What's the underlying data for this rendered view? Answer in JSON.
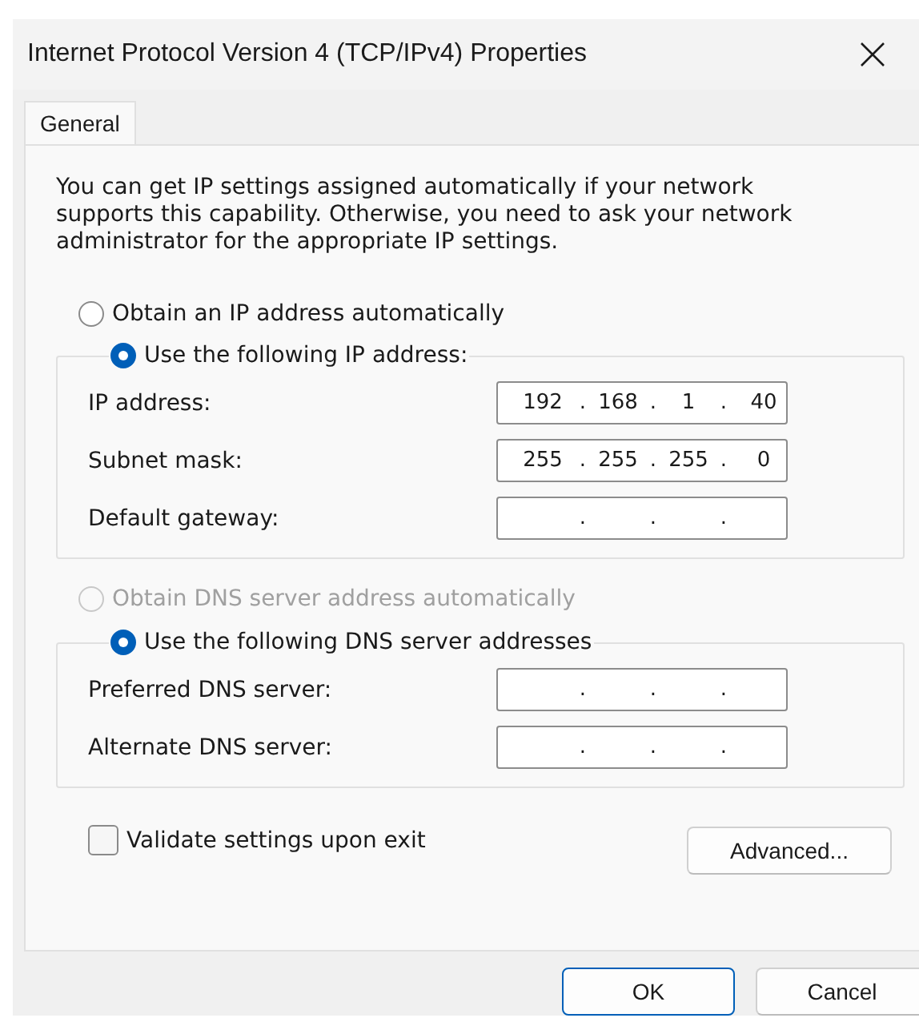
{
  "window": {
    "title": "Internet Protocol Version 4 (TCP/IPv4) Properties"
  },
  "tabs": [
    {
      "label": "General",
      "selected": true
    }
  ],
  "intro": "You can get IP settings assigned automatically if your network supports this capability. Otherwise, you need to ask your network administrator for the appropriate IP settings.",
  "ip_mode": [
    {
      "label": "Obtain an IP address automatically",
      "selected": false,
      "disabled": false
    },
    {
      "label": "Use the following IP address:",
      "selected": true,
      "disabled": false
    }
  ],
  "ip_fields": [
    {
      "label": "IP address:",
      "parts": [
        {
          "kind": "octet",
          "text": "192"
        },
        {
          "kind": "dot",
          "text": "."
        },
        {
          "kind": "octet",
          "text": "168"
        },
        {
          "kind": "dot",
          "text": "."
        },
        {
          "kind": "octet",
          "text": "1"
        },
        {
          "kind": "dot",
          "text": "."
        },
        {
          "kind": "octet",
          "text": "40"
        }
      ]
    },
    {
      "label": "Subnet mask:",
      "parts": [
        {
          "kind": "octet",
          "text": "255"
        },
        {
          "kind": "dot",
          "text": "."
        },
        {
          "kind": "octet",
          "text": "255"
        },
        {
          "kind": "dot",
          "text": "."
        },
        {
          "kind": "octet",
          "text": "255"
        },
        {
          "kind": "dot",
          "text": "."
        },
        {
          "kind": "octet",
          "text": "0"
        }
      ]
    },
    {
      "label": "Default gateway:",
      "parts": [
        {
          "kind": "dot",
          "text": "."
        },
        {
          "kind": "dot",
          "text": "."
        },
        {
          "kind": "dot",
          "text": "."
        }
      ]
    }
  ],
  "dns_mode": [
    {
      "label": "Obtain DNS server address automatically",
      "selected": false,
      "disabled": true
    },
    {
      "label": "Use the following DNS server addresses",
      "selected": true,
      "disabled": false
    }
  ],
  "dns_fields": [
    {
      "label": "Preferred DNS server:",
      "parts": [
        {
          "kind": "dot",
          "text": "."
        },
        {
          "kind": "dot",
          "text": "."
        },
        {
          "kind": "dot",
          "text": "."
        }
      ]
    },
    {
      "label": "Alternate DNS server:",
      "parts": [
        {
          "kind": "dot",
          "text": "."
        },
        {
          "kind": "dot",
          "text": "."
        },
        {
          "kind": "dot",
          "text": "."
        }
      ]
    }
  ],
  "validate": {
    "label": "Validate settings upon exit",
    "checked": false
  },
  "advanced": {
    "label": "Advanced..."
  },
  "buttons": [
    {
      "label": "OK",
      "default": true
    },
    {
      "label": "Cancel",
      "default": false
    }
  ]
}
